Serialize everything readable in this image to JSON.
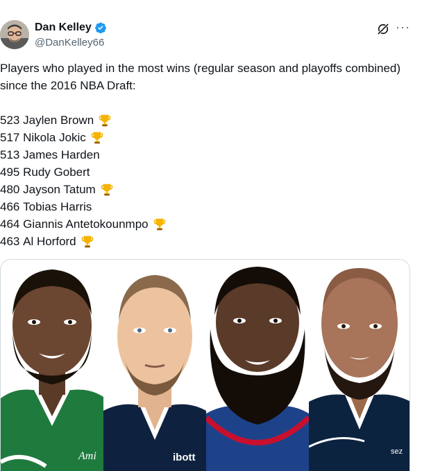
{
  "tweet": {
    "author_name": "Dan Kelley",
    "handle": "@DanKelley66",
    "intro": "Players who played in the most wins (regular season and playoffs combined) since the 2016 NBA Draft:",
    "players": [
      {
        "wins": "523",
        "name": "Jaylen Brown",
        "champion": true
      },
      {
        "wins": "517",
        "name": "Nikola Jokic",
        "champion": true
      },
      {
        "wins": "513",
        "name": "James Harden",
        "champion": false
      },
      {
        "wins": "495",
        "name": "Rudy Gobert",
        "champion": false
      },
      {
        "wins": "480",
        "name": "Jayson Tatum",
        "champion": true
      },
      {
        "wins": "466",
        "name": "Tobias Harris",
        "champion": false
      },
      {
        "wins": "464",
        "name": "Giannis Antetokounmpo",
        "champion": true
      },
      {
        "wins": "463",
        "name": "Al Horford",
        "champion": true
      }
    ]
  },
  "icons": {
    "verified": "verified-badge-icon",
    "grok": "grok-icon",
    "more": "more-icon",
    "trophy": "trophy-emoji"
  },
  "media": {
    "jersey_texts": [
      "Ami",
      "ibott",
      "sez"
    ]
  },
  "colors": {
    "verified_blue": "#1d9bf0",
    "secondary_text": "#536471",
    "celtics_green": "#1f7a3e",
    "nuggets_navy": "#0e2240",
    "clippers_blue": "#1d428a",
    "clippers_red": "#c8102e",
    "wolves_navy": "#0c2340"
  }
}
